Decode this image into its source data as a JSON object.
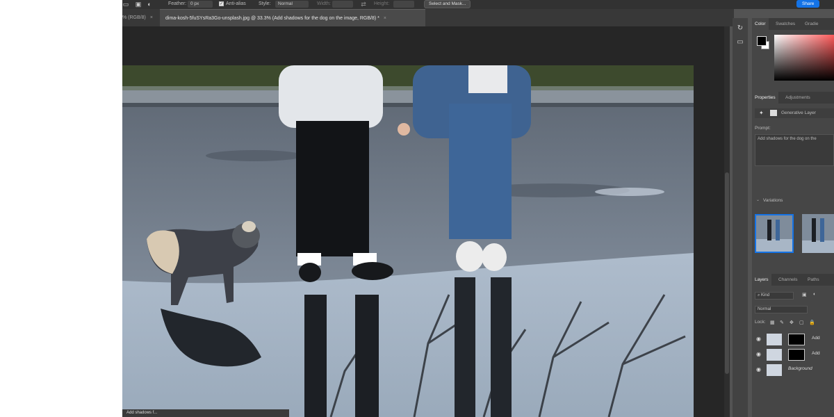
{
  "options_bar": {
    "feather_label": "Feather:",
    "feather_value": "0 px",
    "antialias_label": "Anti-alias",
    "style_label": "Style:",
    "style_value": "Normal",
    "width_label": "Width:",
    "height_label": "Height:",
    "select_mask_label": "Select and Mask...",
    "share_label": "Share"
  },
  "tabs": [
    {
      "label": "% (RGB/8)",
      "close": "×"
    },
    {
      "label": "dima-kosh-5fuSYsRa3Go-unsplash.jpg @ 33.3% (Add shadows for the dog on the image, RGB/8) *",
      "close": "×"
    }
  ],
  "status_bar": {
    "text": "Add shadows f..."
  },
  "panel": {
    "color_tabs": [
      "Color",
      "Swatches",
      "Gradie"
    ],
    "properties_tabs": [
      "Properties",
      "Adjustments"
    ],
    "generative_layer_label": "Generative Layer",
    "prompt_label": "Prompt:",
    "prompt_text": "Add shadows for the dog on the",
    "variations_label": "Variations",
    "layers_tabs": [
      "Layers",
      "Channels",
      "Paths"
    ],
    "kind_label": "Kind",
    "blend_mode": "Normal",
    "lock_label": "Lock:",
    "layers": [
      {
        "name": "Add",
        "has_mask": true
      },
      {
        "name": "Add",
        "has_mask": true
      },
      {
        "name": "Background",
        "has_mask": false
      }
    ]
  },
  "colors": {
    "accent": "#1473e6",
    "app_bg": "#535353",
    "panel_bg": "#464646",
    "canvas_bg": "#262626",
    "foreground_swatch": "#000000",
    "background_swatch": "#ffffff"
  },
  "icons": {
    "tools": [
      "history-brush-icon",
      "comment-icon"
    ],
    "options": [
      "marquee-icon",
      "add-selection-icon",
      "swap-icon"
    ]
  }
}
